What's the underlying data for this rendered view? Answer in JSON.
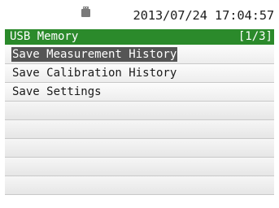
{
  "status": {
    "usb_icon": "usb-storage-icon",
    "datetime": "2013/07/24 17:04:57"
  },
  "title_bar": {
    "title": "USB Memory",
    "page_indicator": "[1/3]",
    "color": "#2b8a2b"
  },
  "menu": {
    "selected_index": 0,
    "items": [
      {
        "label": "Save Measurement History"
      },
      {
        "label": "Save Calibration History"
      },
      {
        "label": "Save Settings"
      }
    ]
  }
}
